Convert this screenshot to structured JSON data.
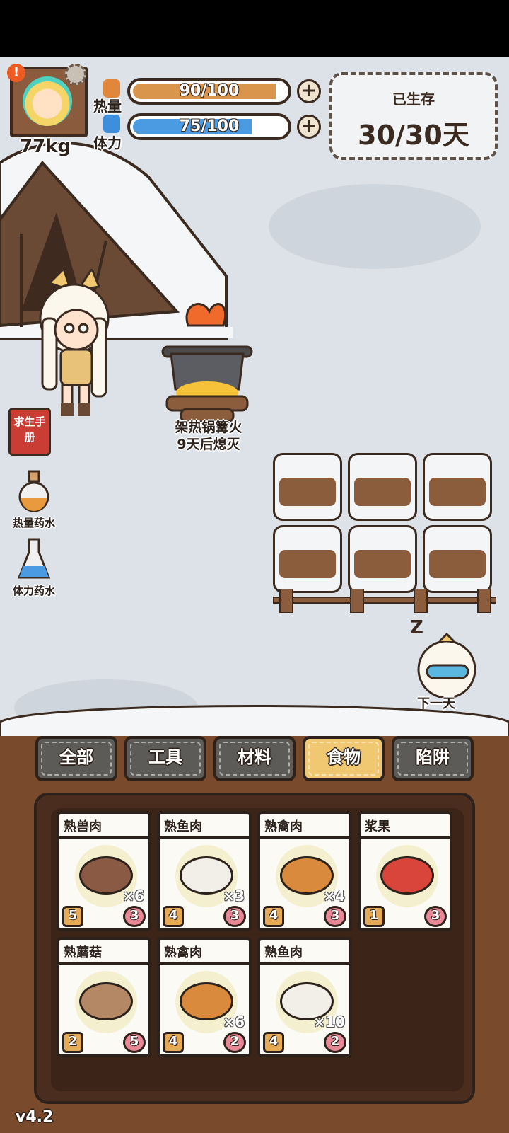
{
  "hud": {
    "weight": "77kg",
    "heat_label": "热量",
    "heat_value": "90/100",
    "heat_fraction": 0.9,
    "stamina_label": "体力",
    "stamina_value": "75/100",
    "stamina_fraction": 0.75,
    "survive_label": "已生存",
    "survive_days": "30/30天"
  },
  "side": {
    "manual_label": "求生手册",
    "heat_potion_label": "热量药水",
    "stamina_potion_label": "体力药水"
  },
  "campfire": {
    "line1": "架热锅篝火",
    "line2": "9天后熄灭"
  },
  "next_day_label": "下一天",
  "tabs": [
    {
      "label": "全部",
      "active": false
    },
    {
      "label": "工具",
      "active": false
    },
    {
      "label": "材料",
      "active": false
    },
    {
      "label": "食物",
      "active": true
    },
    {
      "label": "陷阱",
      "active": false
    }
  ],
  "items": [
    {
      "name": "熟兽肉",
      "qty": "×6",
      "heat": "5",
      "stamina": "3",
      "color": "#8b5a45"
    },
    {
      "name": "熟鱼肉",
      "qty": "×3",
      "heat": "4",
      "stamina": "3",
      "color": "#f1efe8"
    },
    {
      "name": "熟禽肉",
      "qty": "×4",
      "heat": "4",
      "stamina": "3",
      "color": "#d98a3c"
    },
    {
      "name": "浆果",
      "qty": "",
      "heat": "1",
      "stamina": "3",
      "color": "#d9453b"
    },
    {
      "name": "熟蘑菇",
      "qty": "",
      "heat": "2",
      "stamina": "5",
      "color": "#b48864"
    },
    {
      "name": "熟禽肉",
      "qty": "×6",
      "heat": "4",
      "stamina": "2",
      "color": "#d98a3c"
    },
    {
      "name": "熟鱼肉",
      "qty": "×10",
      "heat": "4",
      "stamina": "2",
      "color": "#f1efe8"
    }
  ],
  "version": "v4.2"
}
